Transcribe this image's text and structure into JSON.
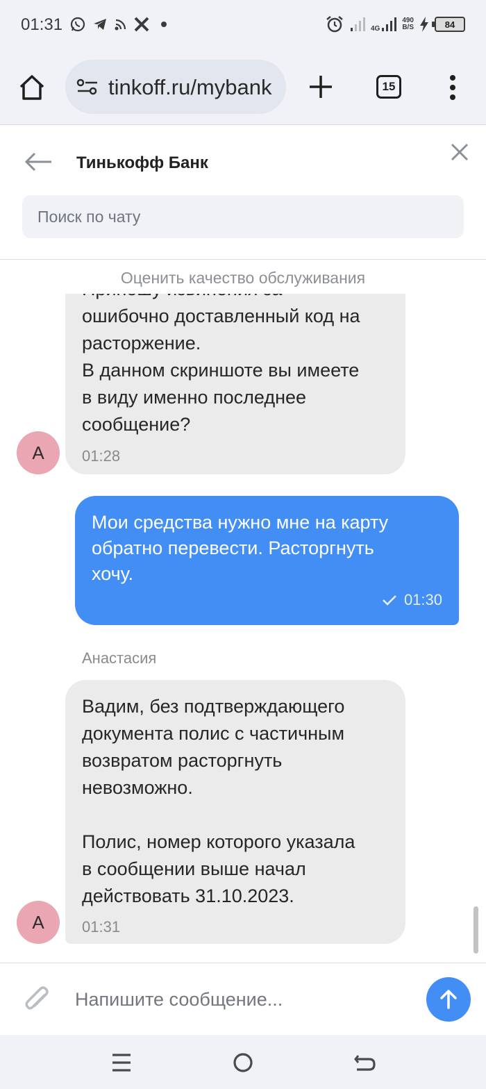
{
  "status_bar": {
    "time": "01:31",
    "icons_left": [
      "whatsapp-icon",
      "telegram-icon",
      "cast-icon",
      "x-icon",
      "dot-icon"
    ],
    "network_type": "4G",
    "speed_value": "490",
    "speed_unit": "B/S",
    "battery": "84"
  },
  "browser": {
    "url": "tinkoff.ru/mybank",
    "tab_count": "15"
  },
  "chat": {
    "title": "Тинькофф Банк",
    "search_placeholder": "Поиск по чату",
    "rate_link": "Оценить качество обслуживания",
    "messages": [
      {
        "direction": "in",
        "avatar_letter": "А",
        "text_clipped": "Приношу извинения за",
        "text": "ошибочно доставленный код на\nрасторжение.\nВ данном скриншоте вы имеете\nв виду именно последнее\nсообщение?",
        "time": "01:28"
      },
      {
        "direction": "out",
        "text": "Мои средства нужно мне на карту\nобратно перевести. Расторгнуть\nхочу.",
        "time": "01:30",
        "status": "sent"
      },
      {
        "direction": "in",
        "sender": "Анастасия",
        "avatar_letter": "А",
        "text": "Вадим, без подтверждающего\nдокумента полис с частичным\nвозвратом расторгнуть\nневозможно.\n\nПолис, номер которого указала\nв сообщении выше начал\nдействовать 31.10.2023.",
        "time": "01:31"
      }
    ],
    "composer_placeholder": "Напишите сообщение..."
  },
  "colors": {
    "accent": "#428ef5",
    "incoming_bubble": "#ebebeb",
    "avatar": "#eaa6b3",
    "system_bar": "#f0f2f7"
  },
  "nav": [
    "menu-icon",
    "home-circle-icon",
    "back-icon"
  ]
}
